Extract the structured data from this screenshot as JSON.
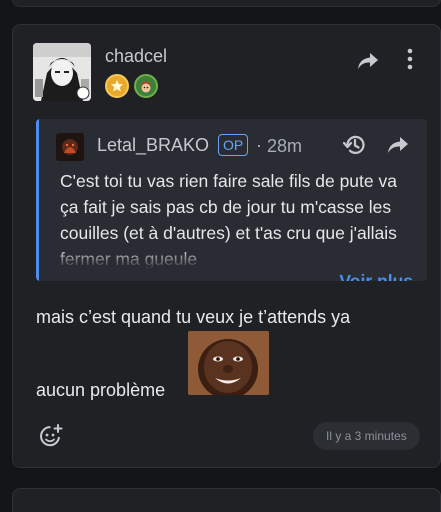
{
  "post": {
    "username": "chadcel",
    "avatar": "avatar-manga-portrait",
    "badges": [
      "star-badge",
      "elf-badge"
    ],
    "share_icon": "share-arrow-icon",
    "more_icon": "more-vertical-icon"
  },
  "quote": {
    "username": "Letal_BRAKO",
    "op_label": "OP",
    "separator": "·",
    "time": "28m",
    "text": "C'est toi tu vas rien faire sale fils de pute va ça fait je sais pas cb de jour tu m'casse les couilles (et à d'autres) et t'as cru que j'allais fermer ma gueule",
    "more_label": "Voir plus",
    "accent": "#4b8ef0"
  },
  "message": {
    "line1": "mais c’est quand tu veux je t’attends ya",
    "line2": "aucun problème",
    "sticker": "smiling-face-sticker"
  },
  "footer": {
    "react_icon": "add-reaction-icon",
    "timestamp": "Il y a 3 minutes"
  }
}
